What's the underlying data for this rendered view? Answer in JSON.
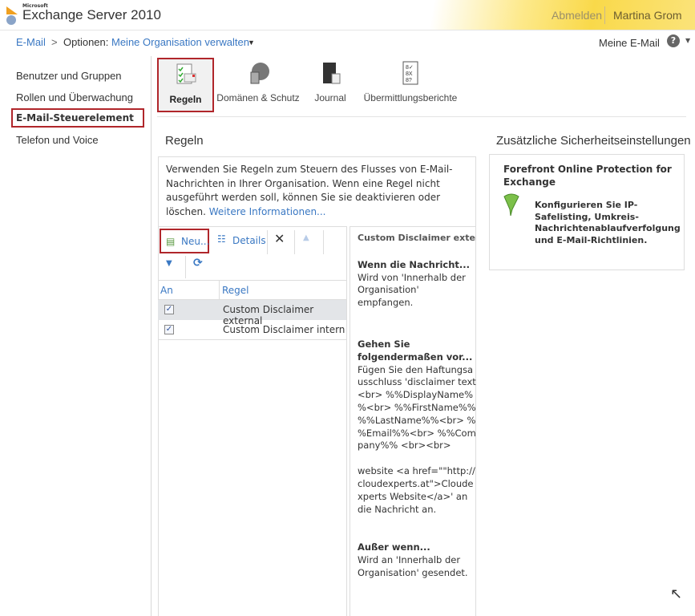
{
  "header": {
    "brand_small": "Microsoft",
    "brand": "Exchange Server 2010",
    "signout": "Abmelden",
    "user": "Martina Grom"
  },
  "breadcrumb": {
    "root": "E-Mail",
    "sep": ">",
    "label": "Optionen:",
    "current": "Meine Organisation verwalten",
    "my_mail": "Meine E-Mail",
    "help": "?"
  },
  "leftnav": {
    "items": [
      "Benutzer und Gruppen",
      "Rollen und Überwachung",
      "E-Mail-Steuerelement",
      "Telefon und Voice"
    ]
  },
  "toolbar": {
    "items": [
      "Regeln",
      "Domänen & Schutz",
      "Journal",
      "Übermittlungsberichte"
    ]
  },
  "rules": {
    "title": "Regeln",
    "description": "Verwenden Sie Regeln zum Steuern des Flusses von E-Mail-Nachrichten in Ihrer Organisation. Wenn eine Regel nicht ausgeführt werden soll, können Sie sie deaktivieren oder löschen.",
    "more_link": "Weitere Informationen...",
    "new_label": "Neu...",
    "details_label": "Details",
    "columns": [
      "An",
      "Regel"
    ],
    "rows": [
      {
        "name": "Custom Disclaimer external",
        "enabled": true,
        "selected": true
      },
      {
        "name": "Custom Disclaimer intern",
        "enabled": true,
        "selected": false
      }
    ]
  },
  "details": {
    "title": "Custom Disclaimer external",
    "when_heading": "Wenn die Nachricht...",
    "when_text": "Wird von 'Innerhalb der Organisation' empfangen.",
    "do_heading": "Gehen Sie folgendermaßen vor...",
    "do_text": "Fügen Sie den Haftungsausschluss 'disclaimer text<br> %%DisplayName%%<br> %%FirstName%% %%LastName%%<br> %%Email%%<br> %%Company%% <br><br>",
    "do_text2": "website <a href=\"\"http://cloudexperts.at\">Cloudexperts Website</a>' an die Nachricht an.",
    "except_heading": "Außer wenn...",
    "except_text": "Wird an 'Innerhalb der Organisation' gesendet."
  },
  "security": {
    "title": "Zusätzliche Sicherheitseinstellungen",
    "heading": "Forefront Online Protection for Exchange",
    "link": "Konfigurieren Sie IP-Safelisting, Umkreis-Nachrichtenablaufverfolgung und E-Mail-Richtlinien."
  }
}
